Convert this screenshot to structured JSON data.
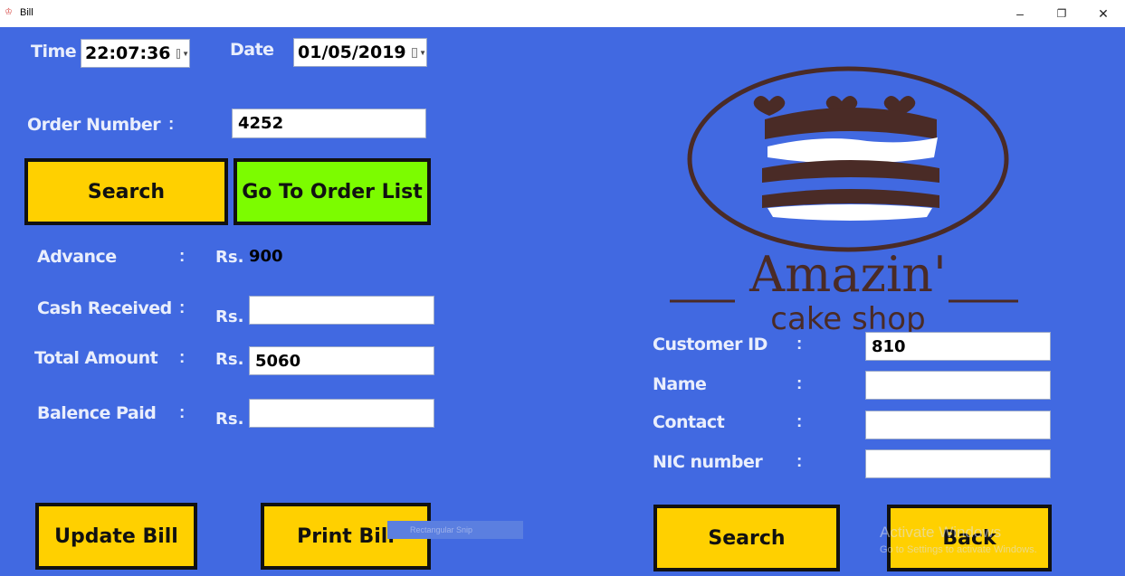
{
  "window": {
    "title": "Bill",
    "icon": "app-icon",
    "controls": [
      "–",
      "❐",
      "✕"
    ]
  },
  "header": {
    "time_label": "Time",
    "time_value": "22:07:36",
    "date_label": "Date",
    "date_value": "01/05/2019"
  },
  "order": {
    "label": "Order Number",
    "colon": ":",
    "value": "4252"
  },
  "buttons": {
    "search_top": "Search",
    "order_list": "Go To Order List",
    "update_bill": "Update Bill",
    "print_bill": "Print Bill",
    "search_bottom": "Search",
    "back": "Back"
  },
  "payment": {
    "currency": "Rs.",
    "advance_label": "Advance",
    "advance_value": "900",
    "cash_label": "Cash Received",
    "cash_value": "",
    "total_label": "Total  Amount",
    "total_value": "5060",
    "balance_label": "Balence Paid",
    "balance_value": ""
  },
  "customer": {
    "id_label": "Customer ID",
    "id_value": "810",
    "name_label": "Name",
    "name_value": "",
    "contact_label": "Contact",
    "contact_value": "",
    "nic_label": "NIC number",
    "nic_value": ""
  },
  "logo": {
    "brand": "Amazin'",
    "tagline": "cake shop"
  },
  "overlay": {
    "snip_text": "Rectangular Snip",
    "watermark_title": "Activate Windows",
    "watermark_sub": "Go to Settings to activate Windows."
  },
  "colors": {
    "background": "#4169e1",
    "button_yellow": "#ffd000",
    "button_green": "#7cfc00",
    "logo_brown": "#4a2b26"
  }
}
